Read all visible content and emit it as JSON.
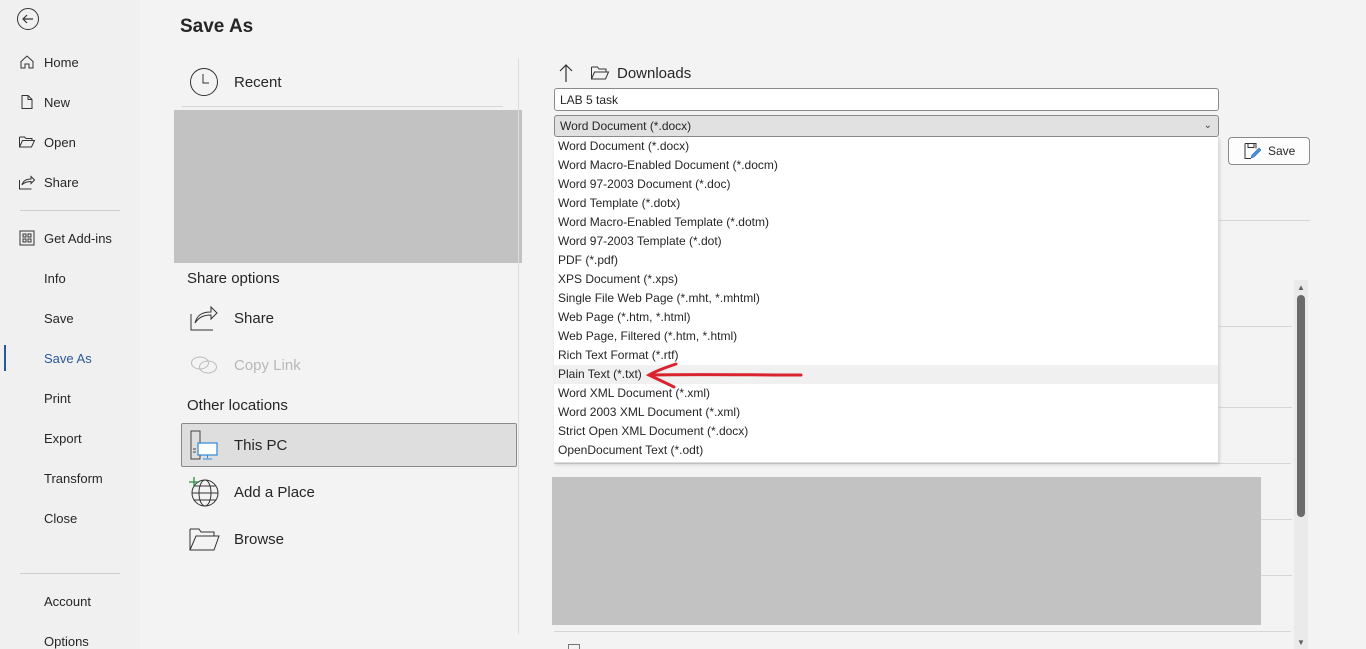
{
  "nav": {
    "back_icon": "back-arrow-circle-icon",
    "items": [
      {
        "label": "Home",
        "icon": "home-icon"
      },
      {
        "label": "New",
        "icon": "new-document-icon"
      },
      {
        "label": "Open",
        "icon": "open-folder-icon"
      },
      {
        "label": "Share",
        "icon": "share-icon"
      },
      {
        "label": "Get Add-ins",
        "icon": "add-ins-grid-icon"
      },
      {
        "label": "Info"
      },
      {
        "label": "Save"
      },
      {
        "label": "Save As",
        "active": true
      },
      {
        "label": "Print"
      },
      {
        "label": "Export"
      },
      {
        "label": "Transform"
      },
      {
        "label": "Close"
      },
      {
        "label": "Account"
      },
      {
        "label": "Options"
      }
    ]
  },
  "page": {
    "title": "Save As"
  },
  "locations": {
    "recent_label": "Recent",
    "share_options_header": "Share options",
    "share_label": "Share",
    "copy_link_label": "Copy Link",
    "other_locations_header": "Other locations",
    "this_pc_label": "This PC",
    "add_place_label": "Add a Place",
    "browse_label": "Browse"
  },
  "save_panel": {
    "current_folder": "Downloads",
    "filename_value": "LAB 5 task",
    "filetype_selected": "Word Document (*.docx)",
    "save_button_label": "Save",
    "filetype_options": [
      "Word Document (*.docx)",
      "Word Macro-Enabled Document (*.docm)",
      "Word 97-2003 Document (*.doc)",
      "Word Template (*.dotx)",
      "Word Macro-Enabled Template (*.dotm)",
      "Word 97-2003 Template (*.dot)",
      "PDF (*.pdf)",
      "XPS Document (*.xps)",
      "Single File Web Page (*.mht, *.mhtml)",
      "Web Page (*.htm, *.html)",
      "Web Page, Filtered (*.htm, *.html)",
      "Rich Text Format (*.rtf)",
      "Plain Text (*.txt)",
      "Word XML Document (*.xml)",
      "Word 2003 XML Document (*.xml)",
      "Strict Open XML Document (*.docx)",
      "OpenDocument Text (*.odt)"
    ],
    "highlighted_option": "Plain Text (*.txt)"
  },
  "colors": {
    "accent": "#2b579a",
    "annotation_arrow": "#d9232e",
    "redaction": "#c2c2c2"
  }
}
